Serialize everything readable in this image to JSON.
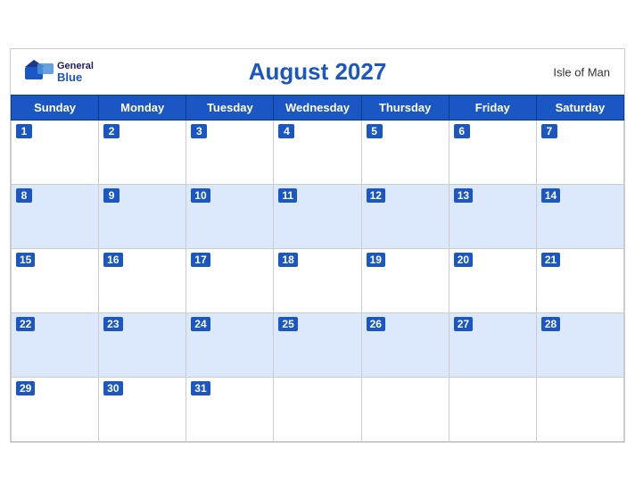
{
  "header": {
    "title": "August 2027",
    "region": "Isle of Man",
    "logo_general": "General",
    "logo_blue": "Blue"
  },
  "weekdays": [
    "Sunday",
    "Monday",
    "Tuesday",
    "Wednesday",
    "Thursday",
    "Friday",
    "Saturday"
  ],
  "weeks": [
    [
      {
        "date": "1",
        "shaded": false
      },
      {
        "date": "2",
        "shaded": false
      },
      {
        "date": "3",
        "shaded": false
      },
      {
        "date": "4",
        "shaded": false
      },
      {
        "date": "5",
        "shaded": false
      },
      {
        "date": "6",
        "shaded": false
      },
      {
        "date": "7",
        "shaded": false
      }
    ],
    [
      {
        "date": "8",
        "shaded": true
      },
      {
        "date": "9",
        "shaded": true
      },
      {
        "date": "10",
        "shaded": true
      },
      {
        "date": "11",
        "shaded": true
      },
      {
        "date": "12",
        "shaded": true
      },
      {
        "date": "13",
        "shaded": true
      },
      {
        "date": "14",
        "shaded": true
      }
    ],
    [
      {
        "date": "15",
        "shaded": false
      },
      {
        "date": "16",
        "shaded": false
      },
      {
        "date": "17",
        "shaded": false
      },
      {
        "date": "18",
        "shaded": false
      },
      {
        "date": "19",
        "shaded": false
      },
      {
        "date": "20",
        "shaded": false
      },
      {
        "date": "21",
        "shaded": false
      }
    ],
    [
      {
        "date": "22",
        "shaded": true
      },
      {
        "date": "23",
        "shaded": true
      },
      {
        "date": "24",
        "shaded": true
      },
      {
        "date": "25",
        "shaded": true
      },
      {
        "date": "26",
        "shaded": true
      },
      {
        "date": "27",
        "shaded": true
      },
      {
        "date": "28",
        "shaded": true
      }
    ],
    [
      {
        "date": "29",
        "shaded": false
      },
      {
        "date": "30",
        "shaded": false
      },
      {
        "date": "31",
        "shaded": false
      },
      {
        "date": "",
        "shaded": false
      },
      {
        "date": "",
        "shaded": false
      },
      {
        "date": "",
        "shaded": false
      },
      {
        "date": "",
        "shaded": false
      }
    ]
  ]
}
